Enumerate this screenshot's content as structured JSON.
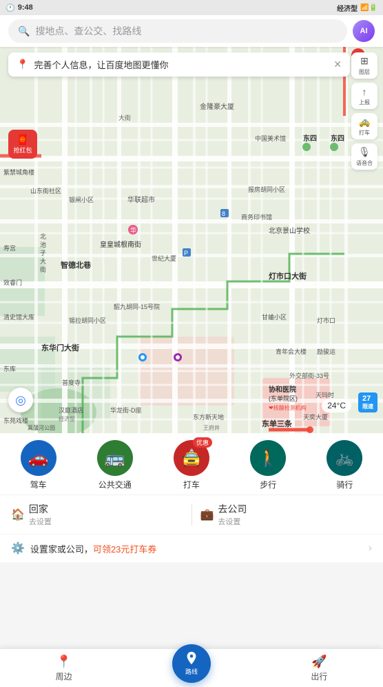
{
  "statusBar": {
    "time": "9:48",
    "networkType": "经济型",
    "icons": [
      "signal",
      "wifi",
      "battery"
    ]
  },
  "searchBar": {
    "placeholder": "搜地点、查公交、找路线",
    "avatarText": "AI"
  },
  "notification": {
    "text": "完善个人信息，让百度地图更懂你",
    "icon": "📍"
  },
  "redPacket": {
    "label": "抢红包",
    "topLabel": "🧧"
  },
  "mapTools": [
    {
      "icon": "⊞",
      "label": "图层"
    },
    {
      "icon": "↑",
      "label": "上报"
    },
    {
      "icon": "🚕",
      "label": "打车"
    },
    {
      "icon": "🎙",
      "label": "语音合"
    }
  ],
  "mapInfo": {
    "temperature": "24°C",
    "speedLimit": "27",
    "speedLimitLabel": "限速"
  },
  "navTabs": [
    {
      "label": "驾车",
      "icon": "🚗",
      "color": "tab-blue"
    },
    {
      "label": "公共交通",
      "icon": "🚌",
      "color": "tab-green"
    },
    {
      "label": "打车",
      "icon": "🚖",
      "color": "tab-red",
      "badge": "优惠"
    },
    {
      "label": "步行",
      "icon": "🚶",
      "color": "tab-teal"
    },
    {
      "label": "骑行",
      "icon": "🚲",
      "color": "tab-cyan"
    }
  ],
  "quickDest": [
    {
      "name": "回家",
      "action": "去设置",
      "icon": "🏠"
    },
    {
      "name": "去公司",
      "action": "去设置",
      "icon": "💼"
    }
  ],
  "promo": {
    "text": "设置家或公司，",
    "highlight": "可领23元打车券",
    "icon": "⚙️"
  },
  "bottomTabs": [
    {
      "label": "周边",
      "icon": "📍",
      "active": false
    },
    {
      "label": "路线",
      "icon": "↑",
      "active": true,
      "isCenter": true
    },
    {
      "label": "出行",
      "icon": "🚀",
      "active": false
    }
  ]
}
